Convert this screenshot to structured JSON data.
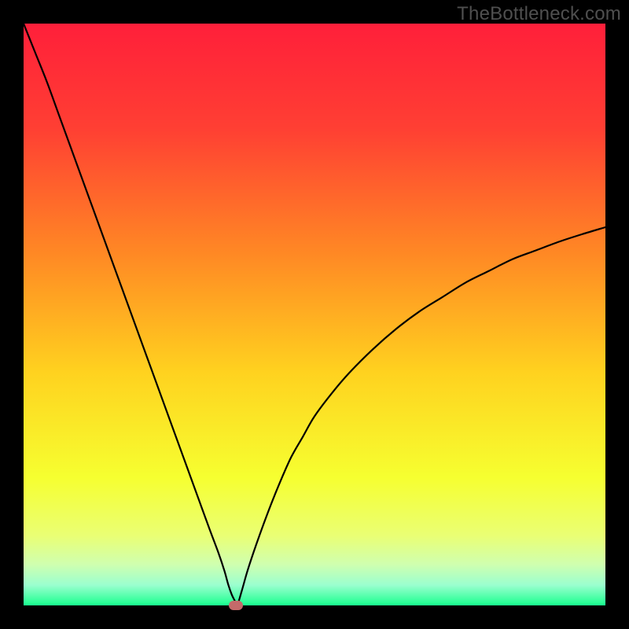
{
  "watermark": "TheBottleneck.com",
  "chart_data": {
    "type": "line",
    "title": "",
    "xlabel": "",
    "ylabel": "",
    "xlim": [
      0,
      100
    ],
    "ylim": [
      0,
      100
    ],
    "grid": false,
    "legend": false,
    "background_gradient_stops": [
      {
        "offset": 0.0,
        "color": "#ff1f3a"
      },
      {
        "offset": 0.18,
        "color": "#ff3f33"
      },
      {
        "offset": 0.4,
        "color": "#ff8a24"
      },
      {
        "offset": 0.6,
        "color": "#ffd21f"
      },
      {
        "offset": 0.78,
        "color": "#f6ff30"
      },
      {
        "offset": 0.88,
        "color": "#eaff74"
      },
      {
        "offset": 0.93,
        "color": "#cfffb0"
      },
      {
        "offset": 0.965,
        "color": "#9bffcf"
      },
      {
        "offset": 1.0,
        "color": "#19ff8e"
      }
    ],
    "series": [
      {
        "name": "curve",
        "color": "#000000",
        "width": 2.2,
        "x": [
          0,
          2,
          4,
          6,
          8,
          10,
          12,
          14,
          16,
          18,
          20,
          22,
          24,
          26,
          28,
          30,
          32,
          33.5,
          34.5,
          35.2,
          35.8,
          36.3,
          36.7,
          37.5,
          38.5,
          40,
          42,
          44,
          46,
          48,
          50,
          53,
          56,
          60,
          64,
          68,
          72,
          76,
          80,
          84,
          88,
          92,
          96,
          100
        ],
        "y": [
          100,
          95,
          90,
          84.5,
          79,
          73.5,
          68,
          62.5,
          57,
          51.5,
          46,
          40.5,
          35,
          29.5,
          24,
          18.5,
          13,
          9,
          6,
          3.5,
          1.8,
          0.8,
          0,
          2.5,
          6,
          10.5,
          16,
          21,
          25.5,
          29,
          32.5,
          36.5,
          40,
          44,
          47.5,
          50.5,
          53,
          55.5,
          57.5,
          59.5,
          61,
          62.5,
          63.8,
          65
        ]
      }
    ],
    "marker": {
      "x": 36.5,
      "y": 0,
      "color": "#c46a6a"
    }
  }
}
